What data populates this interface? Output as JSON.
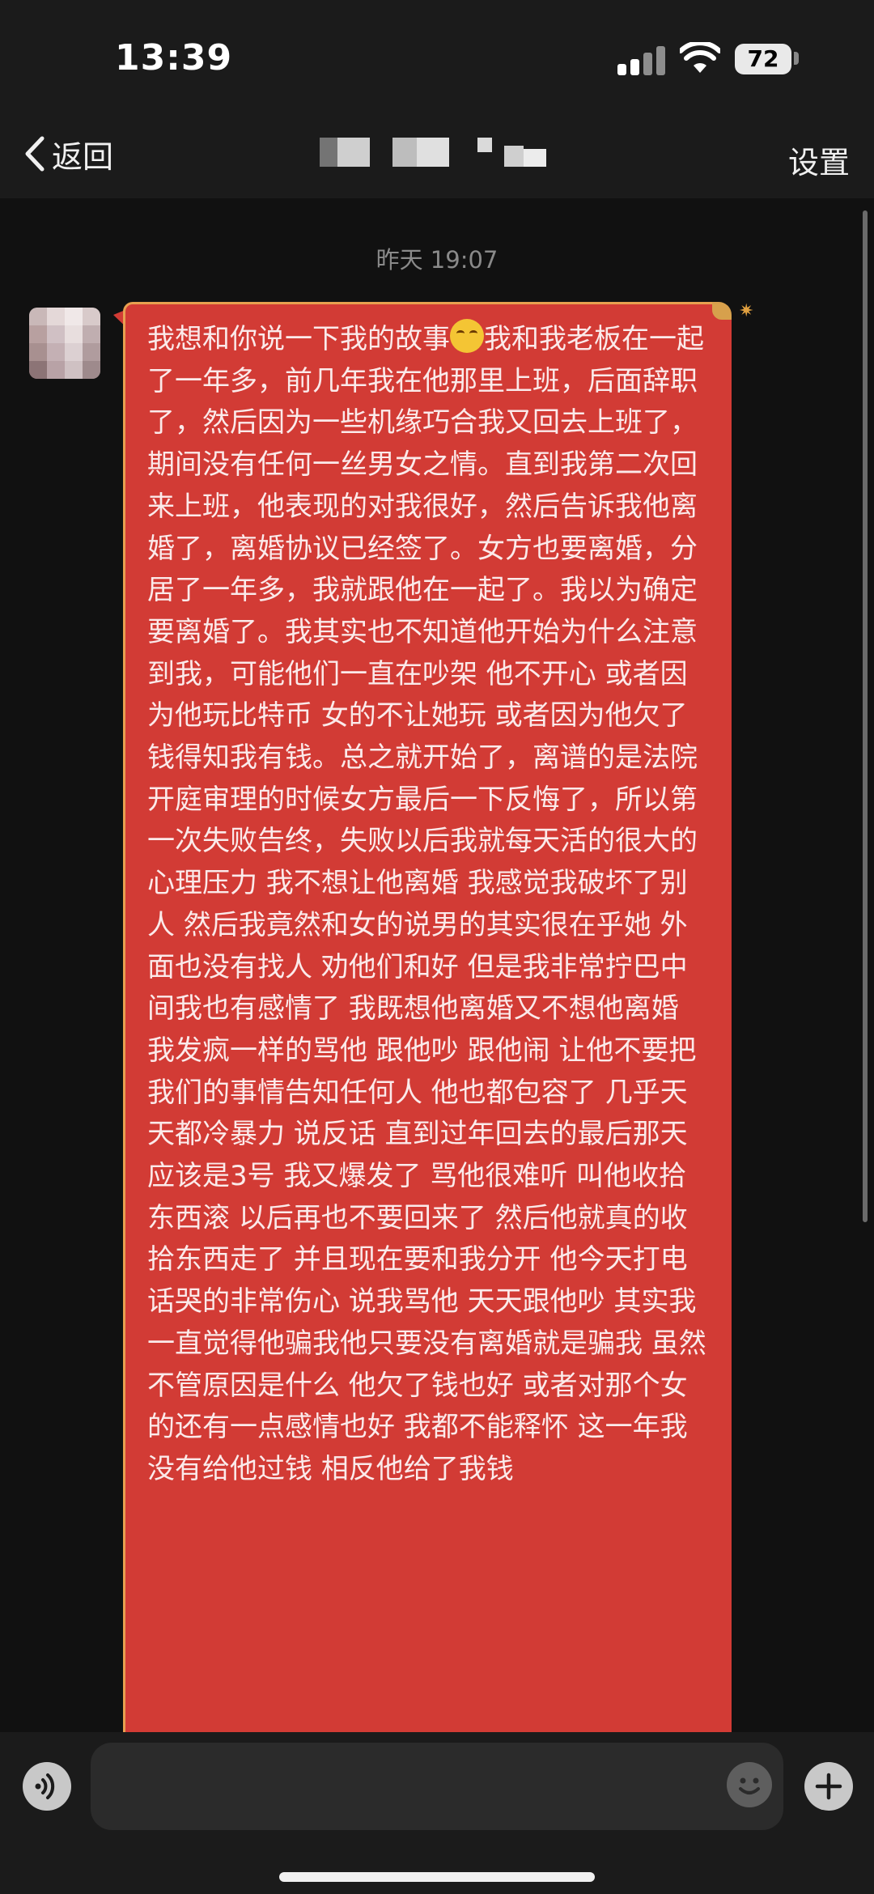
{
  "status_bar": {
    "time": "13:39",
    "battery": "72"
  },
  "nav": {
    "back_label": "返回",
    "settings_label": "设置"
  },
  "chat": {
    "timestamp": "昨天 19:07",
    "message": {
      "before_emoji": "我想和你说一下我的故事",
      "after_emoji": "我和我老板在一起了一年多，前几年我在他那里上班，后面辞职了，然后因为一些机缘巧合我又回去上班了，期间没有任何一丝男女之情。直到我第二次回来上班，他表现的对我很好，然后告诉我他离婚了，离婚协议已经签了。女方也要离婚，分居了一年多，我就跟他在一起了。我以为确定要离婚了。我其实也不知道他开始为什么注意到我，可能他们一直在吵架 他不开心 或者因为他玩比特币 女的不让她玩 或者因为他欠了钱得知我有钱。总之就开始了，离谱的是法院开庭审理的时候女方最后一下反悔了，所以第一次失败告终，失败以后我就每天活的很大的心理压力 我不想让他离婚 我感觉我破坏了别人 然后我竟然和女的说男的其实很在乎她 外面也没有找人 劝他们和好 但是我非常拧巴中间我也有感情了 我既想他离婚又不想他离婚 我发疯一样的骂他 跟他吵 跟他闹 让他不要把我们的事情告知任何人 他也都包容了 几乎天天都冷暴力 说反话 直到过年回去的最后那天 应该是3号 我又爆发了 骂他很难听 叫他收拾东西滚 以后再也不要回来了 然后他就真的收拾东西走了 并且现在要和我分开 他今天打电话哭的非常伤心 说我骂他 天天跟他吵 其实我一直觉得他骗我他只要没有离婚就是骗我 虽然不管原因是什么 他欠了钱也好 或者对那个女的还有一点感情也好 我都不能释怀 这一年我没有给他过钱 相反他给了我钱",
      "emoji": "loudly-crying-face-icon",
      "bubble_color": "#d23b35"
    }
  },
  "icons": {
    "back": "chevron-left-icon",
    "voice": "voice-icon",
    "emoji": "smile-icon",
    "plus": "plus-icon"
  }
}
